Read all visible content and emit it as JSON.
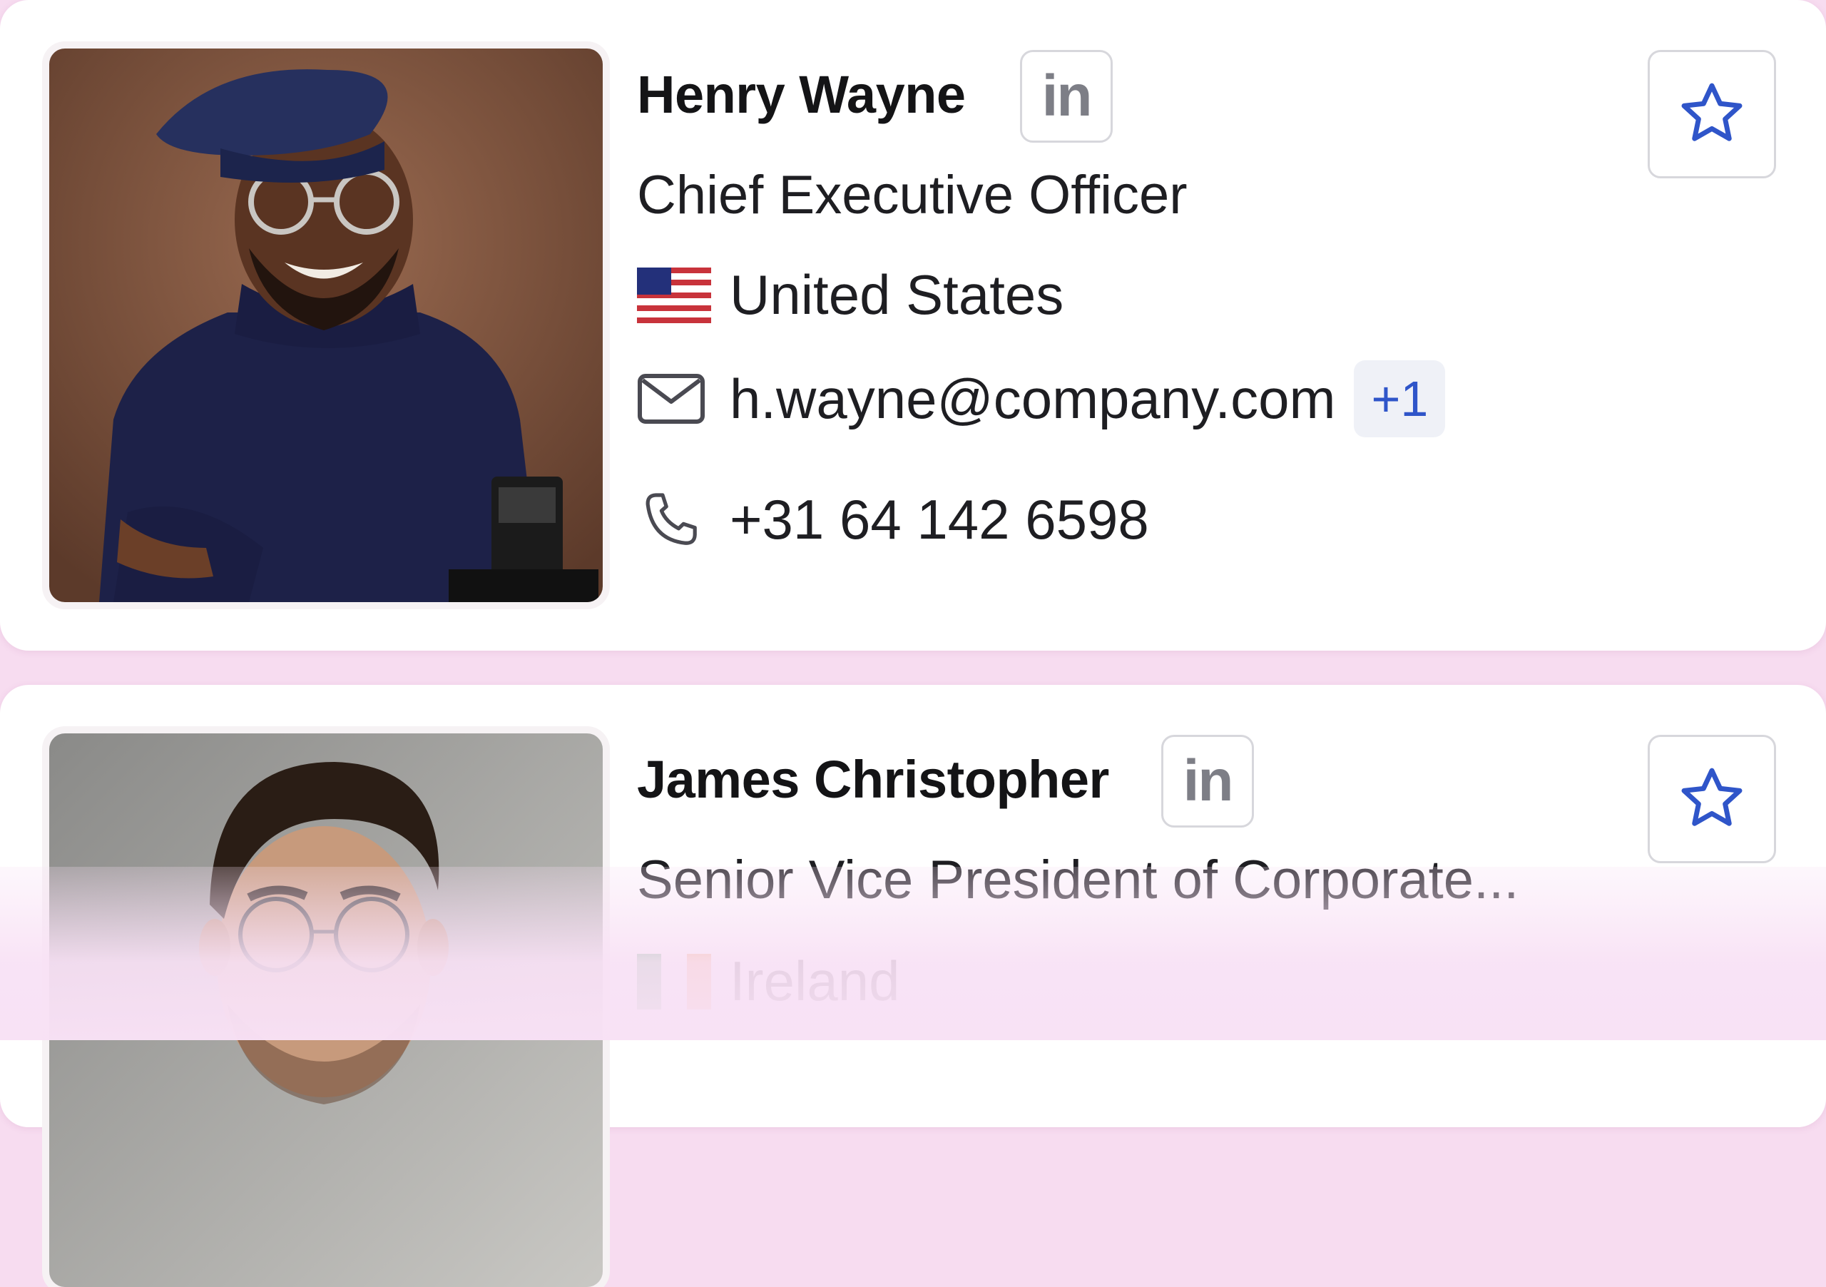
{
  "contacts": [
    {
      "name": "Henry Wayne",
      "linkedin_label": "in",
      "title": "Chief Executive Officer",
      "country": "United States",
      "email": "h.wayne@company.com",
      "email_extra": "+1",
      "phone": "+31 64 142 6598",
      "favorite": false
    },
    {
      "name": "James Christopher",
      "linkedin_label": "in",
      "title": "Senior Vice  President of Corporate...",
      "country": "Ireland",
      "favorite": false
    }
  ],
  "colors": {
    "accent": "#2f55c9",
    "background": "#f7dcf0",
    "card": "#ffffff",
    "border": "#d7d7dc"
  },
  "icons": [
    "linkedin-icon",
    "star-icon",
    "flag-us-icon",
    "flag-ireland-icon",
    "mail-icon",
    "phone-icon"
  ]
}
